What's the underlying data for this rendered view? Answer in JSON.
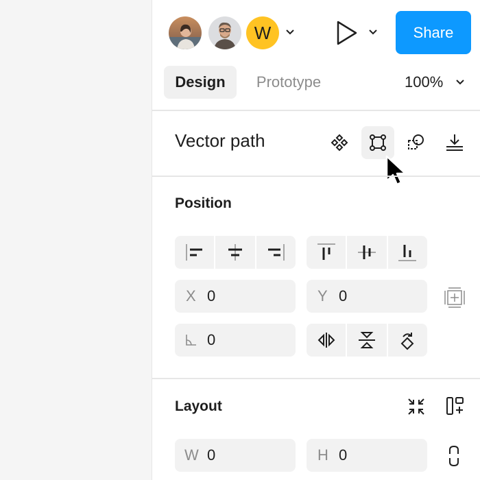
{
  "header": {
    "avatars": [
      {
        "name": "avatar-1",
        "type": "photo"
      },
      {
        "name": "avatar-2",
        "type": "photo"
      },
      {
        "name": "avatar-w",
        "initial": "W",
        "color": "#ffc323"
      }
    ],
    "share_label": "Share",
    "accent": "#0d99ff"
  },
  "tabs": {
    "design": "Design",
    "prototype": "Prototype",
    "zoom": "100%"
  },
  "layer": {
    "name": "Vector path",
    "actions": [
      "component-icon",
      "frame-selection-icon",
      "boolean-icon",
      "export-icon"
    ]
  },
  "position": {
    "title": "Position",
    "x_label": "X",
    "x_value": "0",
    "y_label": "Y",
    "y_value": "0",
    "rotation_value": "0"
  },
  "layout": {
    "title": "Layout",
    "w_label": "W",
    "w_value": "0",
    "h_label": "H",
    "h_value": "0"
  }
}
